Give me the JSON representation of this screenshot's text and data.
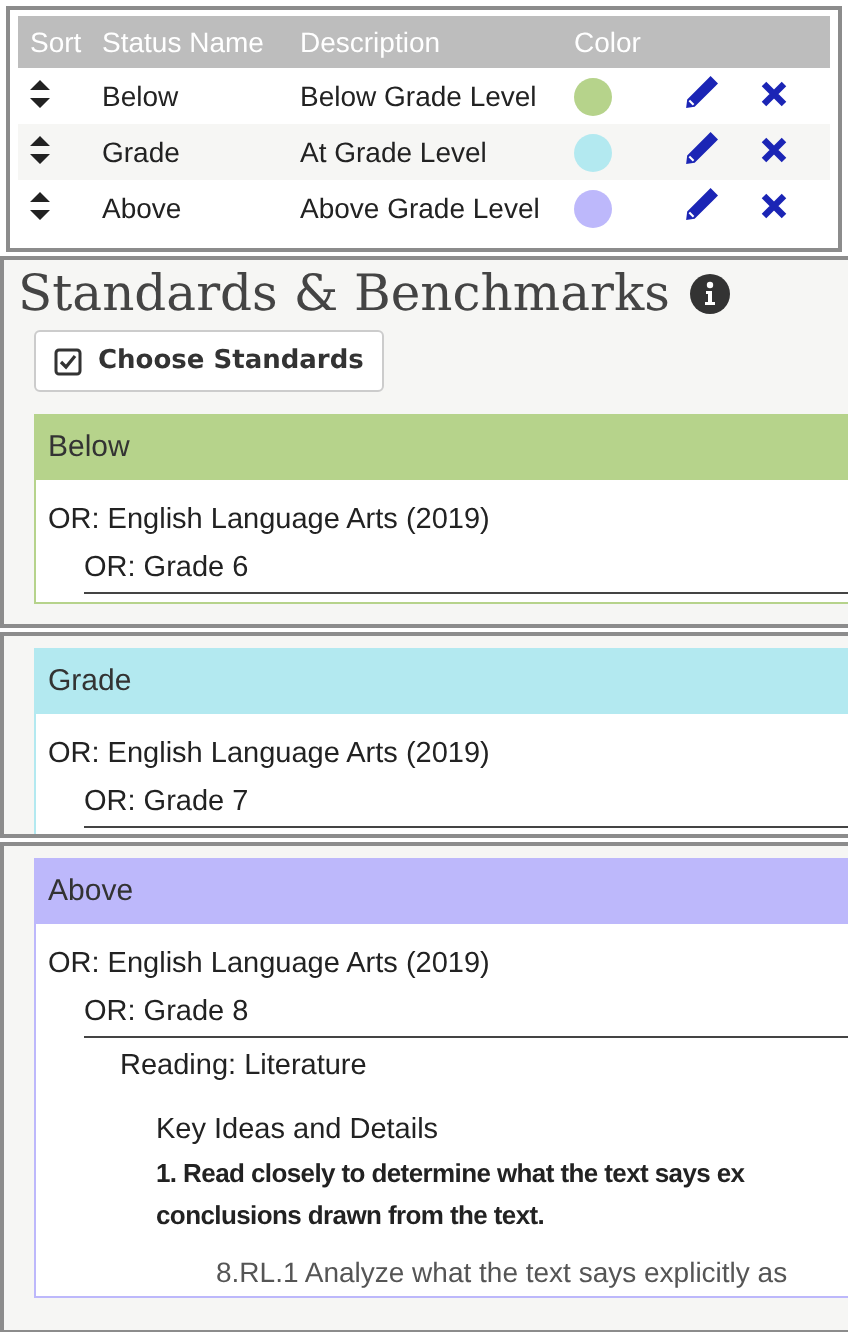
{
  "status_table": {
    "columns": [
      "Sort",
      "Status Name",
      "Description",
      "Color"
    ],
    "rows": [
      {
        "name": "Below",
        "description": "Below Grade Level",
        "color": "#b6d38b"
      },
      {
        "name": "Grade",
        "description": "At Grade Level",
        "color": "#b3e9f0"
      },
      {
        "name": "Above",
        "description": "Above Grade Level",
        "color": "#bdb8fb"
      }
    ]
  },
  "standards": {
    "title": "Standards & Benchmarks",
    "button": "Choose Standards",
    "groups": [
      {
        "name": "Below",
        "color": "#b6d38b",
        "tree": [
          {
            "kind": "subject",
            "text": "OR: English Language Arts (2019)",
            "children": [
              {
                "kind": "grade",
                "text": "OR: Grade 6"
              }
            ]
          }
        ]
      },
      {
        "name": "Grade",
        "color": "#b3e9f0",
        "tree": [
          {
            "kind": "subject",
            "text": "OR: English Language Arts (2019)",
            "children": [
              {
                "kind": "grade",
                "text": "OR: Grade 7"
              }
            ]
          }
        ]
      },
      {
        "name": "Above",
        "color": "#bdb8fb",
        "tree": [
          {
            "kind": "subject",
            "text": "OR: English Language Arts (2019)",
            "children": [
              {
                "kind": "grade",
                "text": "OR: Grade 8",
                "children": [
                  {
                    "kind": "domain",
                    "text": "Reading: Literature",
                    "children": [
                      {
                        "kind": "cluster",
                        "text": "Key Ideas and Details",
                        "lines": [
                          "1. Read closely to determine what the text says ex",
                          "conclusions drawn from the text."
                        ],
                        "children": [
                          {
                            "kind": "benchmark",
                            "text": "8.RL.1 Analyze what the text says explicitly as"
                          }
                        ]
                      }
                    ]
                  }
                ]
              }
            ]
          }
        ]
      }
    ]
  }
}
